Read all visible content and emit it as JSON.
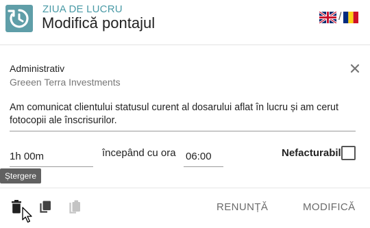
{
  "header": {
    "app_name": "ZIUA DE LUCRU",
    "title": "Modifică pontajul",
    "lang_separator": "/",
    "languages": [
      "en-flag-icon",
      "ro-flag-icon"
    ]
  },
  "entry": {
    "project": "Administrativ",
    "client": "Greeen Terra Investments",
    "description": "Am comunicat clientului statusul curent al dosarului aflat în lucru și am cerut fotocopii ale înscrisurilor.",
    "duration": "1h 00m",
    "start_label": "începând cu ora",
    "start_time": "06:00",
    "nonbillable_label": "Nefacturabil",
    "nonbillable_checked": false
  },
  "tooltip": {
    "text": "Ștergere"
  },
  "footer": {
    "cancel_label": "RENUNȚĂ",
    "save_label": "MODIFICĂ"
  },
  "colors": {
    "accent": "#4a9aa6",
    "logo_bg": "#5f9ea8",
    "tooltip_bg": "#616161",
    "button_text": "#6b6b6b",
    "disabled_icon": "#c4c4c4"
  }
}
